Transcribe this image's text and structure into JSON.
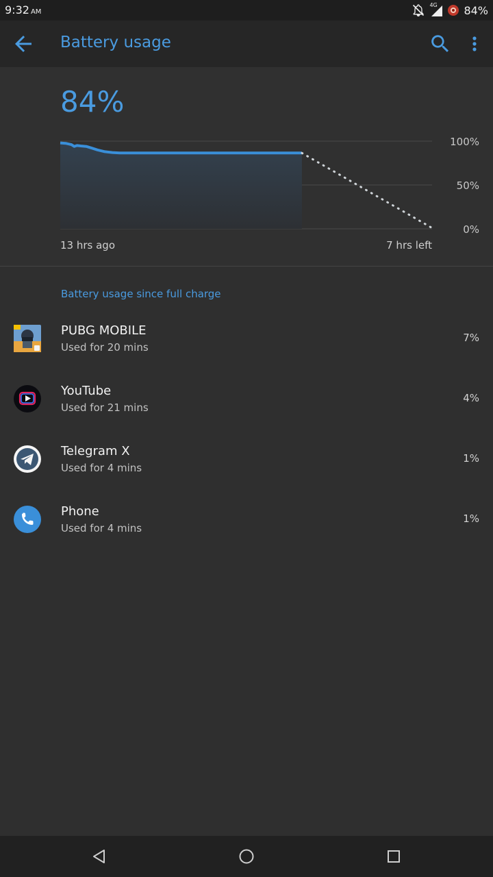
{
  "status_bar": {
    "time": "9:32",
    "ampm": "AM",
    "network_label": "4G",
    "battery_text": "84%"
  },
  "app_bar": {
    "title": "Battery usage",
    "icons": [
      "arrow-back-icon",
      "search-icon",
      "more-vert-icon"
    ]
  },
  "summary": {
    "level": "84%"
  },
  "chart_data": {
    "type": "line",
    "y_tick_labels": [
      "100%",
      "50%",
      "0%"
    ],
    "x_start_label": "13 hrs ago",
    "x_end_label": "7 hrs left",
    "ylim": [
      0,
      100
    ],
    "xlim": [
      0,
      20
    ],
    "series": [
      {
        "style": "solid",
        "x": [
          0,
          0.3,
          0.6,
          0.75,
          0.9,
          1.1,
          1.4,
          1.7,
          2.0,
          2.4,
          2.8,
          3.2,
          5,
          8,
          10,
          13
        ],
        "y": [
          98,
          97.5,
          96,
          94,
          95,
          94.5,
          94,
          92,
          90,
          88,
          87,
          86.5,
          86.5,
          86.5,
          86.5,
          86.5
        ]
      },
      {
        "style": "dotted",
        "x": [
          13,
          20
        ],
        "y": [
          86.5,
          1
        ]
      }
    ],
    "grid": true,
    "colors": {
      "line": "#3a8fd9",
      "fill": "#344250",
      "grid": "#4a4a4a",
      "projection": "#cfd4d8"
    }
  },
  "usage": {
    "section_title": "Battery usage since full charge",
    "apps": [
      {
        "name": "PUBG MOBILE",
        "used": "Used for 20 mins",
        "percent": "7%",
        "icon": "pubg-mobile-icon"
      },
      {
        "name": "YouTube",
        "used": "Used for 21 mins",
        "percent": "4%",
        "icon": "youtube-icon"
      },
      {
        "name": "Telegram X",
        "used": "Used for 4 mins",
        "percent": "1%",
        "icon": "telegram-x-icon"
      },
      {
        "name": "Phone",
        "used": "Used for 4 mins",
        "percent": "1%",
        "icon": "phone-icon"
      }
    ]
  },
  "nav_bar": {
    "icons": [
      "nav-back-icon",
      "nav-home-icon",
      "nav-recents-icon"
    ]
  },
  "colors": {
    "accent": "#4a9be0",
    "background": "#2f2f2f",
    "app_bar": "#262626"
  }
}
